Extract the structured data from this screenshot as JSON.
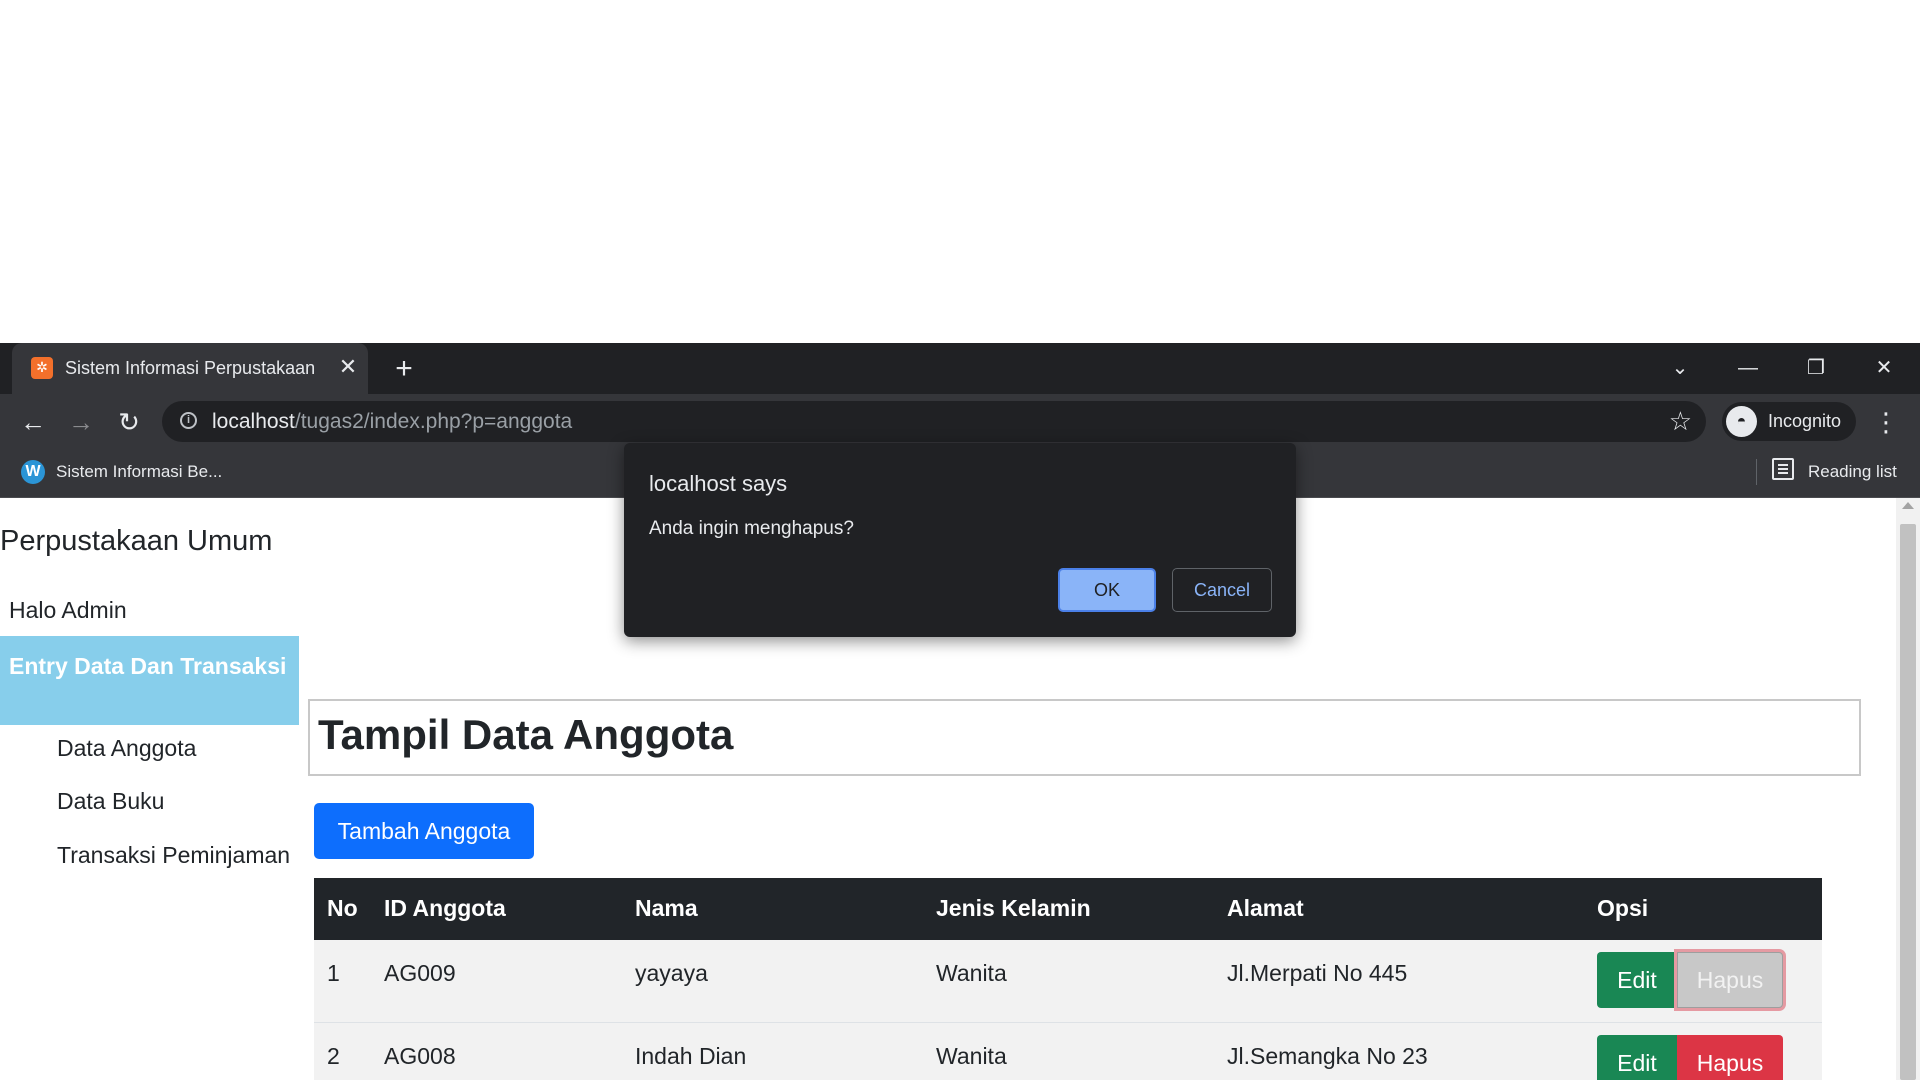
{
  "browser": {
    "tab_title": "Sistem Informasi Perpustakaan",
    "tab_favicon": "xampp-icon",
    "url_host": "localhost",
    "url_path": "/tugas2/index.php?p=anggota",
    "incognito_label": "Incognito",
    "bookmark_label": "Sistem Informasi Be...",
    "reading_list_label": "Reading list",
    "icons": {
      "tab_close": "✕",
      "new_tab": "+",
      "tab_search": "⌄",
      "minimize": "—",
      "restore": "❐",
      "close_window": "✕",
      "back": "←",
      "forward": "→",
      "reload": "↻",
      "info": "i",
      "star": "☆",
      "menu": "⋮",
      "bookmark_favicon": "W",
      "incognito": "◓"
    }
  },
  "sidebar": {
    "site_title": "Perpustakaan Umum",
    "greeting": "Halo Admin",
    "active_section": "Entry Data Dan Transaksi",
    "menu": [
      "Data Anggota",
      "Data Buku",
      "Transaksi Peminjaman"
    ]
  },
  "main": {
    "heading": "Tampil Data Anggota",
    "add_button": "Tambah Anggota",
    "table": {
      "headers": [
        "No",
        "ID Anggota",
        "Nama",
        "Jenis Kelamin",
        "Alamat",
        "Opsi"
      ],
      "rows": [
        {
          "no": "1",
          "id": "AG009",
          "nama": "yayaya",
          "jk": "Wanita",
          "alamat": "Jl.Merpati No 445"
        },
        {
          "no": "2",
          "id": "AG008",
          "nama": "Indah Dian",
          "jk": "Wanita",
          "alamat": "Jl.Semangka No 23"
        }
      ],
      "edit_label": "Edit",
      "delete_label": "Hapus"
    }
  },
  "dialog": {
    "title": "localhost says",
    "message": "Anda ingin menghapus?",
    "ok_label": "OK",
    "cancel_label": "Cancel"
  },
  "colors": {
    "primary": "#0d6efd",
    "success": "#198754",
    "danger": "#dc3545",
    "active_section": "#87ceeb",
    "table_header": "#212529",
    "dialog_bg": "#202124",
    "dialog_accent": "#8ab4f8"
  }
}
